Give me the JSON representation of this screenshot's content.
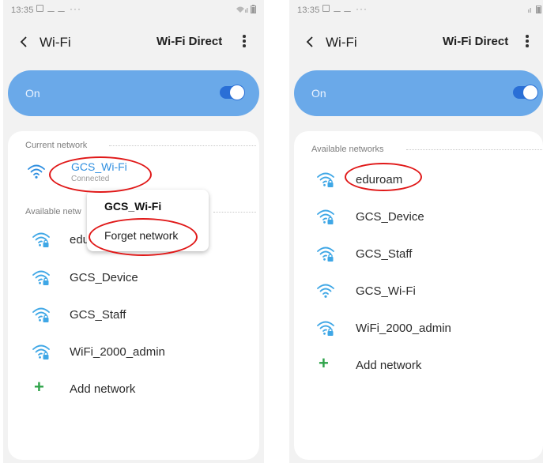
{
  "colors": {
    "accent": "#6aa9e9",
    "toggle": "#2a6fd6",
    "wifi_connected": "#2f8fe0",
    "wifi": "#3fa7e6",
    "add": "#2fa34a",
    "annotation": "#e01818"
  },
  "left": {
    "status": {
      "time": "13:35"
    },
    "header": {
      "title": "Wi-Fi",
      "direct_label": "Wi-Fi Direct"
    },
    "switch": {
      "label": "On",
      "state": "on"
    },
    "current": {
      "section_label": "Current network",
      "network": {
        "name": "GCS_Wi-Fi",
        "status": "Connected",
        "icon": "wifi-icon"
      }
    },
    "available": {
      "section_label": "Available netw",
      "networks": [
        {
          "name": "edu",
          "icon": "wifi-lock-icon"
        },
        {
          "name": "GCS_Device",
          "icon": "wifi-lock-icon"
        },
        {
          "name": "GCS_Staff",
          "icon": "wifi-lock-icon"
        },
        {
          "name": "WiFi_2000_admin",
          "icon": "wifi-lock-icon"
        }
      ],
      "add_label": "Add network"
    },
    "context_menu": {
      "title": "GCS_Wi-Fi",
      "item": "Forget network"
    }
  },
  "right": {
    "status": {
      "time": "13:35"
    },
    "header": {
      "title": "Wi-Fi",
      "direct_label": "Wi-Fi Direct"
    },
    "switch": {
      "label": "On",
      "state": "on"
    },
    "available": {
      "section_label": "Available networks",
      "networks": [
        {
          "name": "eduroam",
          "icon": "wifi-lock-icon"
        },
        {
          "name": "GCS_Device",
          "icon": "wifi-lock-icon"
        },
        {
          "name": "GCS_Staff",
          "icon": "wifi-lock-icon"
        },
        {
          "name": "GCS_Wi-Fi",
          "icon": "wifi-icon"
        },
        {
          "name": "WiFi_2000_admin",
          "icon": "wifi-lock-icon"
        }
      ],
      "add_label": "Add network"
    }
  }
}
